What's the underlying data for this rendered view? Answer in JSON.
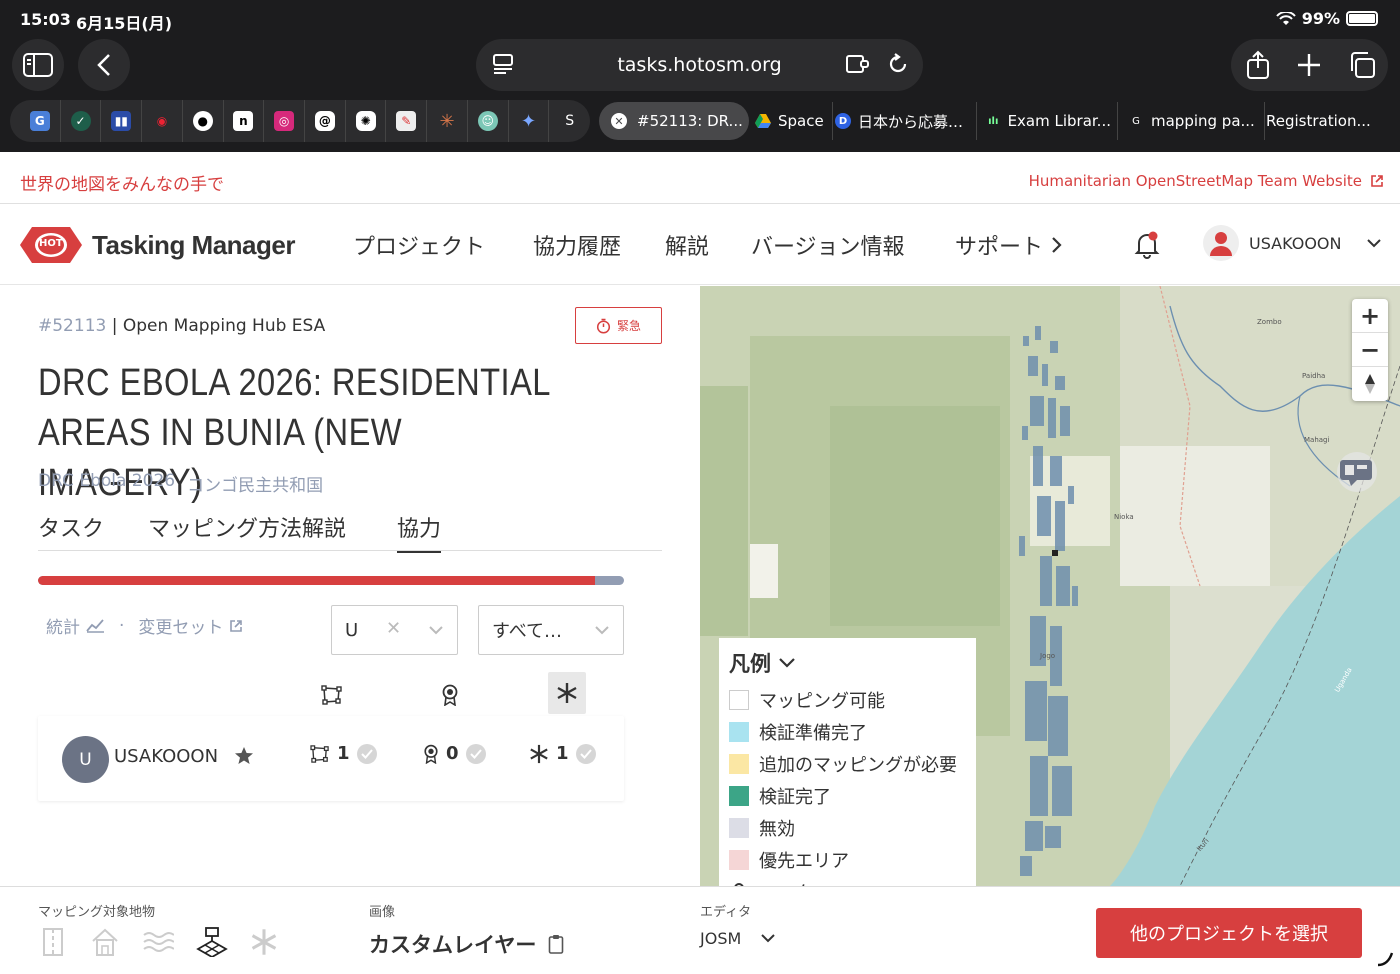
{
  "status_bar": {
    "time": "15:03",
    "date": "6月15日(月)",
    "battery": "99%"
  },
  "browser": {
    "url": "tasks.hotosm.org",
    "tabs": [
      {
        "label": "#52113: DR..."
      },
      {
        "label": "Space"
      },
      {
        "label": "日本から応募…",
        "icon_letter": "D"
      },
      {
        "label": "Exam Librar..."
      },
      {
        "label": "mapping pa...",
        "icon_letter": "G"
      },
      {
        "label": "Registration..."
      }
    ],
    "fav_s_label": "S"
  },
  "site": {
    "slogan": "世界の地図をみんなの手で",
    "hot_link": "Humanitarian OpenStreetMap Team Website",
    "logo_badge": "HOT",
    "logo_text": "Tasking Manager",
    "nav": [
      "プロジェクト",
      "協力履歴",
      "解説",
      "バージョン情報",
      "サポート"
    ],
    "username": "USAKOOON"
  },
  "project": {
    "id": "#52113",
    "org": "| Open Mapping Hub ESA",
    "urgent_label": "緊急",
    "title": "DRC EBOLA 2026: RESIDENTIAL AREAS IN BUNIA (NEW IMAGERY)",
    "campaign": "DRC Ebola 2026",
    "country": "コンゴ民主共和国",
    "tabs": [
      "タスク",
      "マッピング方法解説",
      "協力"
    ],
    "progress": {
      "red_fraction": 0.95
    },
    "stats_link": "統計",
    "changesets_link": "変更セット",
    "user_filter_value": "U",
    "level_filter_value": "すべて…",
    "contributor": {
      "initial": "U",
      "name": "USAKOOON",
      "mapped": "1",
      "validated": "0",
      "total": "1"
    }
  },
  "map": {
    "legend_title": "凡例",
    "legend": [
      {
        "label": "マッピング可能",
        "color": "#ffffff"
      },
      {
        "label": "検証準備完了",
        "color": "#a9e3f0"
      },
      {
        "label": "追加のマッピングが必要",
        "color": "#fbe7a4"
      },
      {
        "label": "検証完了",
        "color": "#3ca587"
      },
      {
        "label": "無効",
        "color": "#dcdde6"
      },
      {
        "label": "優先エリア",
        "color": "#f5d6d6"
      },
      {
        "label": "ロック",
        "color": "#333333"
      }
    ],
    "labels": [
      "Zombo",
      "Paidha",
      "Mahagi",
      "Nioka",
      "Jogo",
      "Ituri",
      "Uganda"
    ]
  },
  "bottom": {
    "features_label": "マッピング対象地物",
    "imagery_label": "画像",
    "imagery_value": "カスタムレイヤー",
    "editor_label": "エディタ",
    "editor_value": "JOSM",
    "button": "他のプロジェクトを選択"
  },
  "colors": {
    "accent": "#d73f3f",
    "muted": "#929db3"
  }
}
